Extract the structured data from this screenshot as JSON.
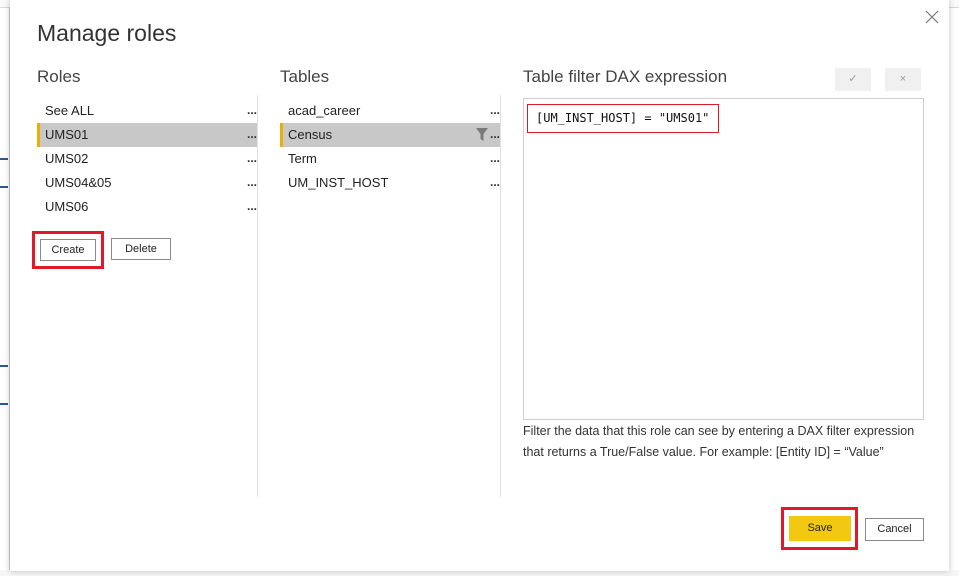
{
  "dialog": {
    "title": "Manage roles",
    "close_icon": "close-icon"
  },
  "roles": {
    "heading": "Roles",
    "items": [
      {
        "label": "See ALL",
        "more": "..."
      },
      {
        "label": "UMS01",
        "more": "...",
        "selected": true
      },
      {
        "label": "UMS02",
        "more": "..."
      },
      {
        "label": "UMS04&05",
        "more": "..."
      },
      {
        "label": "UMS06",
        "more": "..."
      }
    ],
    "create_label": "Create",
    "delete_label": "Delete"
  },
  "tables": {
    "heading": "Tables",
    "items": [
      {
        "label": "acad_career",
        "more": "..."
      },
      {
        "label": "Census",
        "more": "...",
        "selected": true,
        "filter_icon": "filter-icon"
      },
      {
        "label": "Term",
        "more": "..."
      },
      {
        "label": "UM_INST_HOST",
        "more": "..."
      }
    ]
  },
  "dax": {
    "heading": "Table filter DAX expression",
    "apply_icon": "check-icon",
    "discard_icon": "x-icon",
    "apply_glyph": "✓",
    "discard_glyph": "×",
    "expression": "[UM_INST_HOST] = \"UMS01\"",
    "help_line1": "Filter the data that this role can see by entering a DAX filter expression",
    "help_line2": "that returns a True/False value. For example: [Entity ID] = “Value”"
  },
  "footer": {
    "save_label": "Save",
    "cancel_label": "Cancel"
  },
  "colors": {
    "accent": "#f2c811",
    "selected_bar": "#e8b100",
    "highlight_box": "#e0192b",
    "selected_row": "#c8c8c8"
  }
}
